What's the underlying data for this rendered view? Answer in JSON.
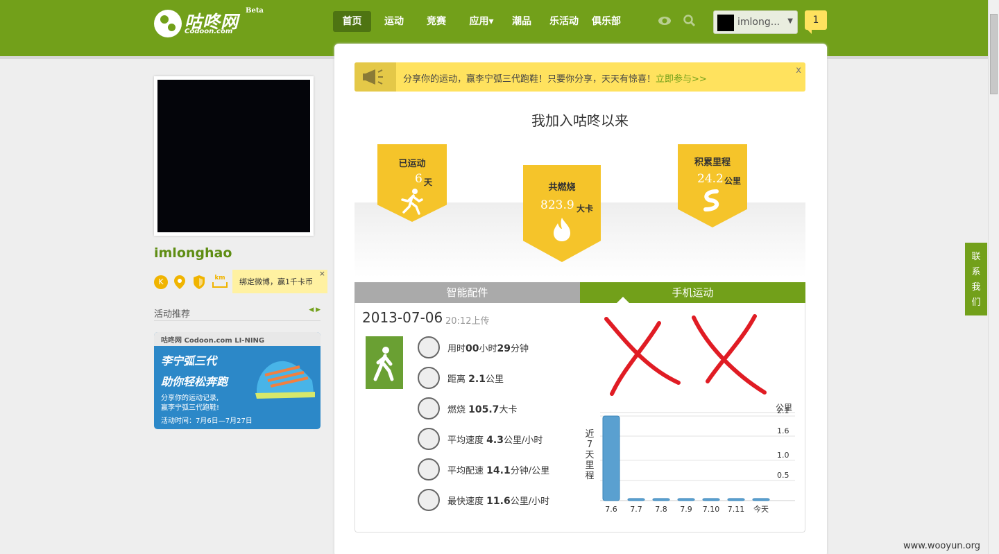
{
  "header": {
    "logo_cn": "咕咚网",
    "logo_en": "Codoon.com",
    "logo_beta": "Beta",
    "nav": [
      "首页",
      "运动",
      "竞赛",
      "应用▾",
      "潮品",
      "乐活动",
      "俱乐部"
    ],
    "active_nav": "首页",
    "user_name": "imlong...",
    "msg_count": "1"
  },
  "profile": {
    "username": "imlonghao",
    "bind_tip": "绑定微博，赢1千卡币",
    "badge_k": "K",
    "badge_km": "km",
    "activity_title": "活动推荐",
    "arrows": "◀ ▶",
    "promo": {
      "brand": "咕咚网 Codoon.com  LI-NING",
      "line1": "李宁弧三代",
      "line2": "助你轻松奔跑",
      "line3": "分享你的运动记录,",
      "line4": "赢李宁弧三代跑鞋!",
      "line5": "活动时间：7月6日—7月27日"
    }
  },
  "notice": {
    "text": "分享你的运动，赢李宁弧三代跑鞋！只要你分享，天天有惊喜！",
    "link": "立即参与>>",
    "close": "x"
  },
  "summary": {
    "title": "我加入咕咚以来",
    "days_label": "已运动",
    "days_value": "6",
    "days_unit": "天",
    "burn_label": "共燃烧",
    "burn_value": "823.9",
    "burn_unit": "大卡",
    "dist_label": "积累里程",
    "dist_value": "24.2",
    "dist_unit": "公里"
  },
  "tabs": {
    "left": "智能配件",
    "right": "手机运动",
    "active": "手机运动"
  },
  "record": {
    "date": "2013-07-06",
    "time": "20:12上传",
    "stats": [
      {
        "icon": "clock-icon",
        "pre": "用时",
        "parts": [
          "00",
          "小时",
          "29",
          "分钟"
        ]
      },
      {
        "icon": "ruler-icon",
        "pre": "距离 ",
        "parts": [
          "2.1",
          "公里"
        ]
      },
      {
        "icon": "flame-icon",
        "pre": "燃烧 ",
        "parts": [
          "105.7",
          "大卡"
        ]
      },
      {
        "icon": "kmh-icon",
        "pre": "平均速度 ",
        "parts": [
          "4.3",
          "公里/小时"
        ]
      },
      {
        "icon": "minkm-icon",
        "pre": "平均配速 ",
        "parts": [
          "14.1",
          "分钟/公里"
        ]
      },
      {
        "icon": "bolt-icon",
        "pre": "最快速度 ",
        "parts": [
          "11.6",
          "公里/小时"
        ]
      }
    ]
  },
  "side_contact": [
    "联",
    "系",
    "我",
    "们"
  ],
  "watermark": "www.wooyun.org",
  "colors": {
    "brand": "#72a01a",
    "accent": "#f5c42a",
    "bar": "#5aa0d0"
  },
  "chart_data": {
    "type": "bar",
    "title": "近7天里程",
    "ylabel": "公里",
    "categories": [
      "7.6",
      "7.7",
      "7.8",
      "7.9",
      "7.10",
      "7.11",
      "今天"
    ],
    "values": [
      2.1,
      0,
      0,
      0,
      0,
      0,
      0
    ],
    "yticks": [
      0.5,
      1.0,
      1.6,
      2.1
    ],
    "ytick_labels": [
      "0.5",
      "1.0",
      "1.6",
      "2.1"
    ],
    "ylim": [
      0,
      2.1
    ],
    "grid": true
  }
}
